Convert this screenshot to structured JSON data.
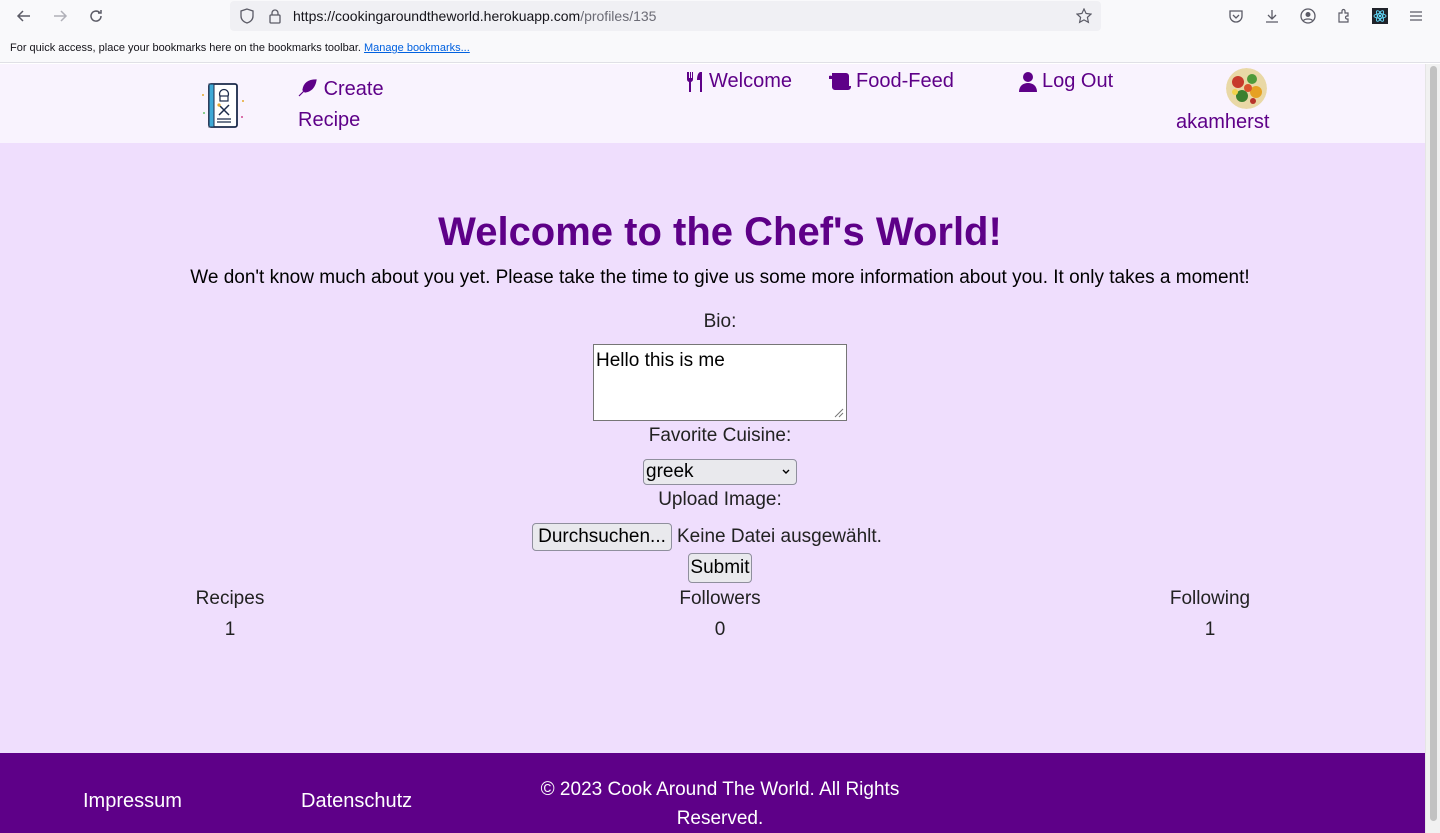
{
  "browser": {
    "url_domain": "https://cookingaroundtheworld.herokuapp.com",
    "url_path": "/profiles/135",
    "bookmarks_message": "For quick access, place your bookmarks here on the bookmarks toolbar.",
    "bookmarks_link": "Manage bookmarks..."
  },
  "header": {
    "create_recipe_label": "Create Recipe",
    "nav": [
      {
        "label": "Welcome",
        "icon": "utensils-icon"
      },
      {
        "label": "Food-Feed",
        "icon": "scroll-icon"
      },
      {
        "label": "Log Out",
        "icon": "user-icon"
      }
    ],
    "username": "akamherst"
  },
  "main": {
    "title": "Welcome to the Chef's World!",
    "subtitle": "We don't know much about you yet. Please take the time to give us some more information about you. It only takes a moment!",
    "bio_label": "Bio:",
    "bio_value": "Hello this is me",
    "cuisine_label": "Favorite Cuisine:",
    "cuisine_value": "greek",
    "upload_label": "Upload Image:",
    "file_button": "Durchsuchen...",
    "file_status": "Keine Datei ausgewählt.",
    "submit_label": "Submit"
  },
  "stats": [
    {
      "label": "Recipes",
      "value": "1"
    },
    {
      "label": "Followers",
      "value": "0"
    },
    {
      "label": "Following",
      "value": "1"
    }
  ],
  "footer": {
    "impressum": "Impressum",
    "datenschutz": "Datenschutz",
    "copyright": "© 2023 Cook Around The World. All Rights Reserved."
  },
  "colors": {
    "brand_purple": "#5e0088",
    "page_background": "#efdefd",
    "header_background": "#f9f3fe"
  }
}
